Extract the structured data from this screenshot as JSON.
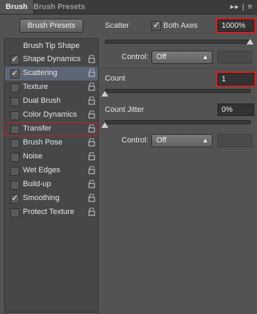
{
  "tabs": {
    "brush": "Brush",
    "brush_presets": "Brush Presets"
  },
  "panel_controls": "▸▸ | ≡",
  "presets_button": "Brush Presets",
  "tip_header": "Brush Tip Shape",
  "options": [
    {
      "label": "Shape Dynamics",
      "checked": true
    },
    {
      "label": "Scattering",
      "checked": true
    },
    {
      "label": "Texture",
      "checked": false
    },
    {
      "label": "Dual Brush",
      "checked": false
    },
    {
      "label": "Color Dynamics",
      "checked": false
    },
    {
      "label": "Transfer",
      "checked": false
    },
    {
      "label": "Brush Pose",
      "checked": false
    },
    {
      "label": "Noise",
      "checked": false
    },
    {
      "label": "Wet Edges",
      "checked": false
    },
    {
      "label": "Build-up",
      "checked": false
    },
    {
      "label": "Smoothing",
      "checked": true
    },
    {
      "label": "Protect Texture",
      "checked": false
    }
  ],
  "scatter": {
    "label": "Scatter",
    "both_axes_label": "Both Axes",
    "both_axes_checked": true,
    "value": "1000%",
    "control_label": "Control:",
    "control_value": "Off"
  },
  "count": {
    "label": "Count",
    "value": "1"
  },
  "count_jitter": {
    "label": "Count Jitter",
    "value": "0%",
    "control_label": "Control:",
    "control_value": "Off"
  },
  "colors": {
    "highlight_red": "#e01b1b",
    "selected_row": "#5c6675"
  }
}
